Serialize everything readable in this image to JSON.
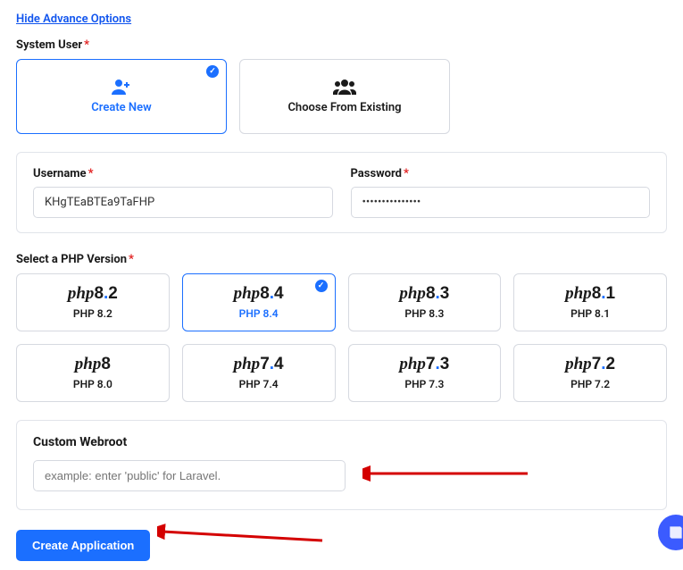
{
  "hide_link": "Hide Advance Options",
  "system_user_label": "System User",
  "system_user_options": {
    "create_new": "Create New",
    "choose_existing": "Choose From Existing"
  },
  "credentials": {
    "username_label": "Username",
    "username_value": "KHgTEaBTEa9TaFHP",
    "password_label": "Password",
    "password_value": "•••••••••••••••"
  },
  "php_section_label": "Select a PHP Version",
  "php_versions": [
    {
      "logo_main": "php",
      "logo_ver_left": "8",
      "logo_ver_right": "2",
      "plain": "PHP 8.2",
      "selected": false
    },
    {
      "logo_main": "php",
      "logo_ver_left": "8",
      "logo_ver_right": "4",
      "plain": "PHP 8.4",
      "selected": true
    },
    {
      "logo_main": "php",
      "logo_ver_left": "8",
      "logo_ver_right": "3",
      "plain": "PHP 8.3",
      "selected": false
    },
    {
      "logo_main": "php",
      "logo_ver_left": "8",
      "logo_ver_right": "1",
      "plain": "PHP 8.1",
      "selected": false
    },
    {
      "logo_main": "php",
      "logo_ver_left": "8",
      "logo_ver_right": "",
      "plain": "PHP 8.0",
      "selected": false
    },
    {
      "logo_main": "php",
      "logo_ver_left": "7",
      "logo_ver_right": "4",
      "plain": "PHP 7.4",
      "selected": false
    },
    {
      "logo_main": "php",
      "logo_ver_left": "7",
      "logo_ver_right": "3",
      "plain": "PHP 7.3",
      "selected": false
    },
    {
      "logo_main": "php",
      "logo_ver_left": "7",
      "logo_ver_right": "2",
      "plain": "PHP 7.2",
      "selected": false
    }
  ],
  "webroot": {
    "label": "Custom Webroot",
    "placeholder": "example: enter 'public' for Laravel."
  },
  "create_button": "Create Application",
  "required_mark": "*"
}
